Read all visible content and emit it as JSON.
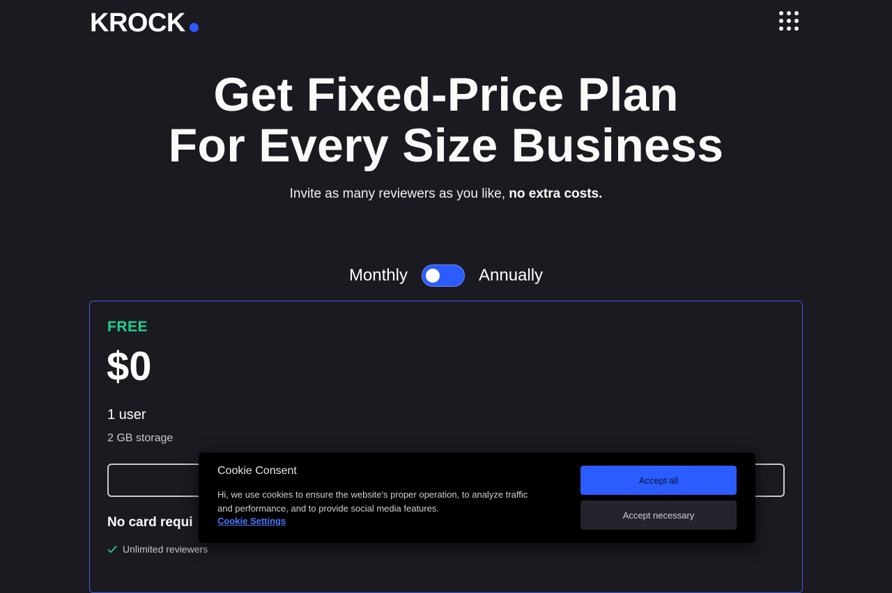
{
  "header": {
    "logo_text": "KROCK",
    "logo_dot_color": "#2a5cff",
    "menu_icon": "grid-dots-icon"
  },
  "hero": {
    "title_line1": "Get Fixed-Price Plan",
    "title_line2": "For Every Size Business",
    "subtitle_plain": "Invite as many reviewers as you like, ",
    "subtitle_bold": "no extra costs."
  },
  "billing": {
    "monthly_label": "Monthly",
    "annually_label": "Annually",
    "selected": "Monthly"
  },
  "plan": {
    "name": "FREE",
    "price": "$0",
    "users": "1 user",
    "storage": "2 GB storage",
    "no_card": "No card requi",
    "features": [
      "Unlimited reviewers"
    ],
    "accent_color": "#1ecf8e",
    "border_color": "#3f5fe0"
  },
  "cookie": {
    "title": "Cookie Consent",
    "text": "Hi, we use cookies to ensure the website's proper operation, to analyze traffic and performance, and to provide social media features.",
    "settings_link": "Cookie Settings",
    "accept_all": "Accept all",
    "accept_necessary": "Accept necessary",
    "accent_color": "#2a5cff"
  },
  "colors": {
    "background": "#1b1a20"
  }
}
